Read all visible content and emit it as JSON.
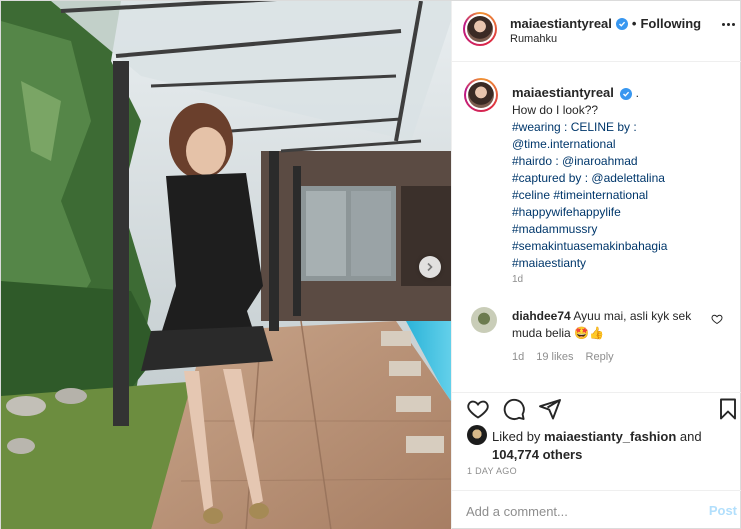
{
  "header": {
    "username": "maiaestiantyreal",
    "separator": "•",
    "follow_label": "Following",
    "location": "Rumahku"
  },
  "caption": {
    "username": "maiaestiantyreal",
    "trailing": ".",
    "lines": [
      {
        "text": "How do I look??",
        "kind": "plain"
      },
      {
        "text": "#wearing : CELINE by :",
        "kind": "tag"
      },
      {
        "text": "@time.international",
        "kind": "tag"
      },
      {
        "text": "#hairdo : @inaroahmad",
        "kind": "tag"
      },
      {
        "text": "#captured by : @adelettalina",
        "kind": "tag"
      },
      {
        "text": "#celine #timeinternational",
        "kind": "tag"
      },
      {
        "text": "#happywifehappylife",
        "kind": "tag"
      },
      {
        "text": "#madammussry",
        "kind": "tag"
      },
      {
        "text": "#semakintuasemakinbahagia",
        "kind": "tag"
      },
      {
        "text": "#maiaestianty",
        "kind": "tag"
      }
    ],
    "time": "1d"
  },
  "comment": {
    "username": "diahdee74",
    "text": "Ayuu mai, asli kyk sek muda belia 🤩👍",
    "time": "1d",
    "likes": "19 likes",
    "reply_label": "Reply"
  },
  "likes": {
    "prefix": "Liked by",
    "liker": "maiaestianty_fashion",
    "and": "and",
    "count": "104,774 others",
    "post_time": "1 DAY AGO"
  },
  "add_comment": {
    "placeholder": "Add a comment...",
    "post_label": "Post"
  },
  "icons": {
    "verified": "verified-badge-icon",
    "like": "heart-icon",
    "comment": "comment-icon",
    "share": "paper-plane-icon",
    "save": "bookmark-icon",
    "carousel": "chevron-right-icon"
  },
  "colors": {
    "link": "#00376b",
    "verified": "#3897f0",
    "post_disabled": "#b2dffc",
    "muted": "#8e8e8e"
  }
}
